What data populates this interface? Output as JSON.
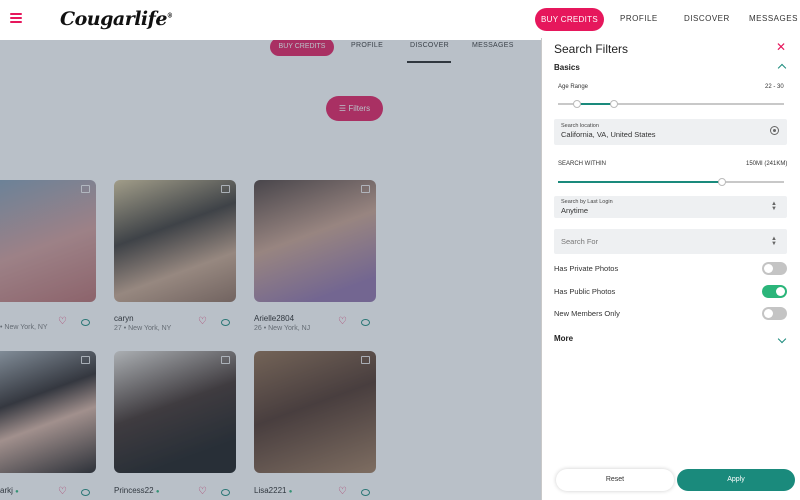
{
  "header": {
    "logo": "Cougarlife",
    "logo_mark": "®",
    "buy_credits": "BUY CREDITS",
    "nav": [
      "PROFILE",
      "DISCOVER",
      "MESSAGES"
    ]
  },
  "background_page": {
    "subnav_buy": "BUY CREDITS",
    "subnav": [
      "PROFILE",
      "DISCOVER",
      "MESSAGES"
    ],
    "filters_button": "Filters",
    "profiles": [
      {
        "name": "",
        "location": "• New York, NY"
      },
      {
        "name": "caryn",
        "location": "27 • New York, NY"
      },
      {
        "name": "Arielle2804",
        "location": "26 • New York, NJ"
      },
      {
        "name": "arkj",
        "location": ""
      },
      {
        "name": "Princess22",
        "location": ""
      },
      {
        "name": "Lisa2221",
        "location": ""
      }
    ]
  },
  "filters": {
    "title": "Search Filters",
    "close_icon": "close-icon",
    "section_basics": "Basics",
    "age_range_label": "Age Range",
    "age_range_value": "22 - 30",
    "age_min": 22,
    "age_max": 30,
    "location_label": "Search location",
    "location_value": "California, VA, United States",
    "search_within_label": "SEARCH WITHIN",
    "search_within_value": "150MI (241KM)",
    "search_within_fraction": 0.72,
    "last_login_label": "Search by Last Login",
    "last_login_value": "Anytime",
    "search_for_placeholder": "Search For",
    "toggles": [
      {
        "label": "Has Private Photos",
        "on": false
      },
      {
        "label": "Has Public Photos",
        "on": true
      },
      {
        "label": "New Members Only",
        "on": false
      }
    ],
    "section_more": "More",
    "reset": "Reset",
    "apply": "Apply"
  },
  "colors": {
    "brand_pink": "#e6175c",
    "teal": "#1a8a7c",
    "toggle_on": "#2bb57a",
    "toggle_off": "#c4c4c4"
  }
}
